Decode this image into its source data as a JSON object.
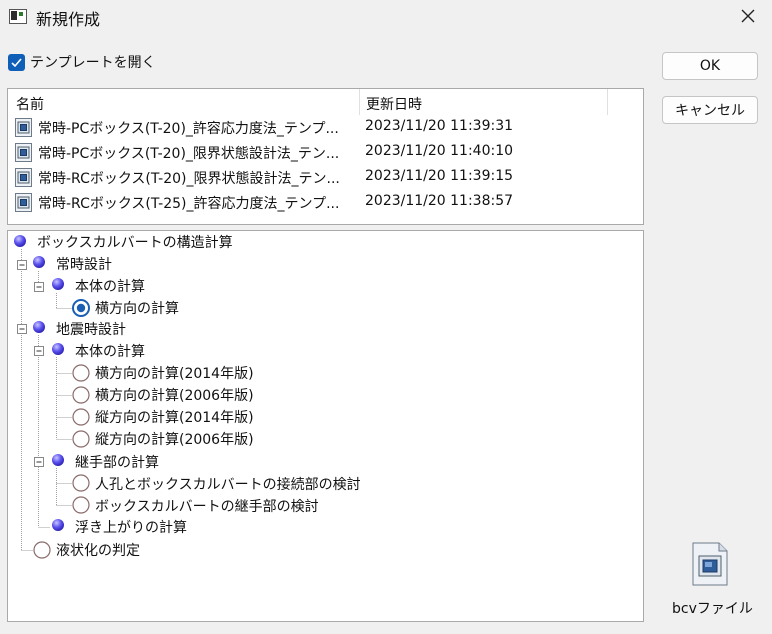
{
  "window": {
    "title": "新規作成"
  },
  "options": {
    "open_template_label": "テンプレートを開く",
    "open_template_checked": true
  },
  "buttons": {
    "ok": "OK",
    "cancel": "キャンセル"
  },
  "file_list": {
    "columns": [
      "名前",
      "更新日時"
    ],
    "rows": [
      {
        "name": "常時-PCボックス(T-20)_許容応力度法_テンプ...",
        "date": "2023/11/20 11:39:31"
      },
      {
        "name": "常時-PCボックス(T-20)_限界状態設計法_テン...",
        "date": "2023/11/20 11:40:10"
      },
      {
        "name": "常時-RCボックス(T-20)_限界状態設計法_テン...",
        "date": "2023/11/20 11:39:15"
      },
      {
        "name": "常時-RCボックス(T-25)_許容応力度法_テンプ...",
        "date": "2023/11/20 11:38:57"
      }
    ]
  },
  "tree": {
    "items": [
      "ボックスカルバートの構造計算",
      "常時設計",
      "本体の計算",
      "横方向の計算",
      "地震時設計",
      "本体の計算",
      "横方向の計算(2014年版)",
      "横方向の計算(2006年版)",
      "縦方向の計算(2014年版)",
      "縦方向の計算(2006年版)",
      "継手部の計算",
      "人孔とボックスカルバートの接続部の検討",
      "ボックスカルバートの継手部の検討",
      "浮き上がりの計算",
      "液状化の判定"
    ]
  },
  "bcv": {
    "label": "bcvファイル"
  }
}
